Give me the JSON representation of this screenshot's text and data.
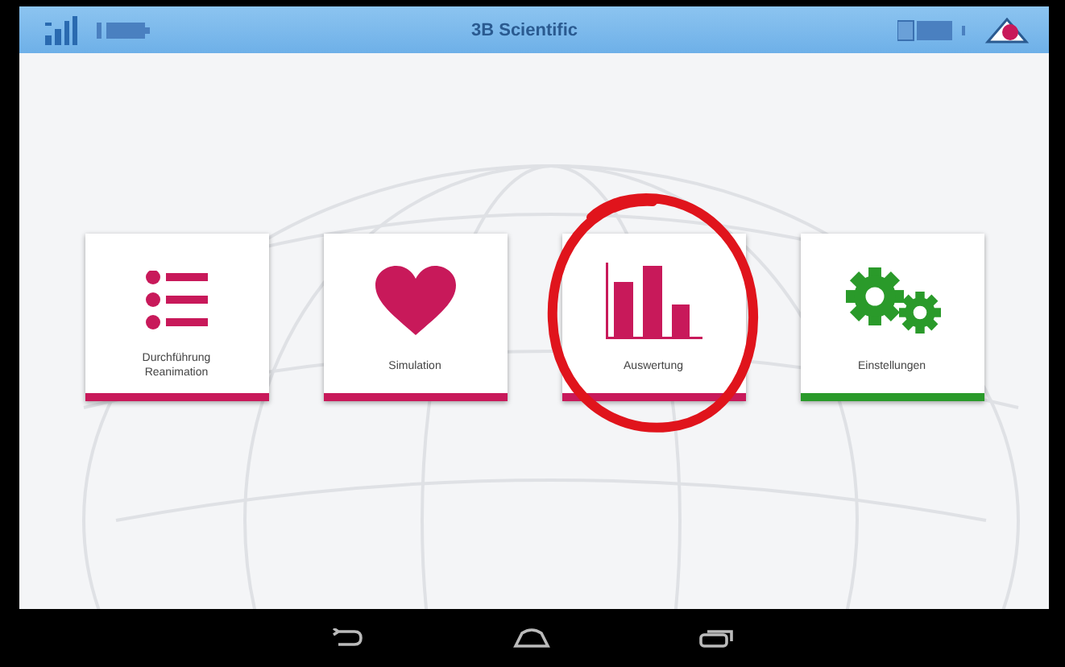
{
  "title_bar": {
    "title": "3B Scientific"
  },
  "tiles": [
    {
      "kind": "list",
      "label": "Durchführung Reanimation",
      "color": "#c8195a",
      "circled": false
    },
    {
      "kind": "heart",
      "label": "Simulation",
      "color": "#c8195a",
      "circled": false
    },
    {
      "kind": "bars",
      "label": "Auswertung",
      "color": "#c8195a",
      "circled": true
    },
    {
      "kind": "gears",
      "label": "Einstellungen",
      "color": "#2a9a2a",
      "circled": false
    }
  ]
}
